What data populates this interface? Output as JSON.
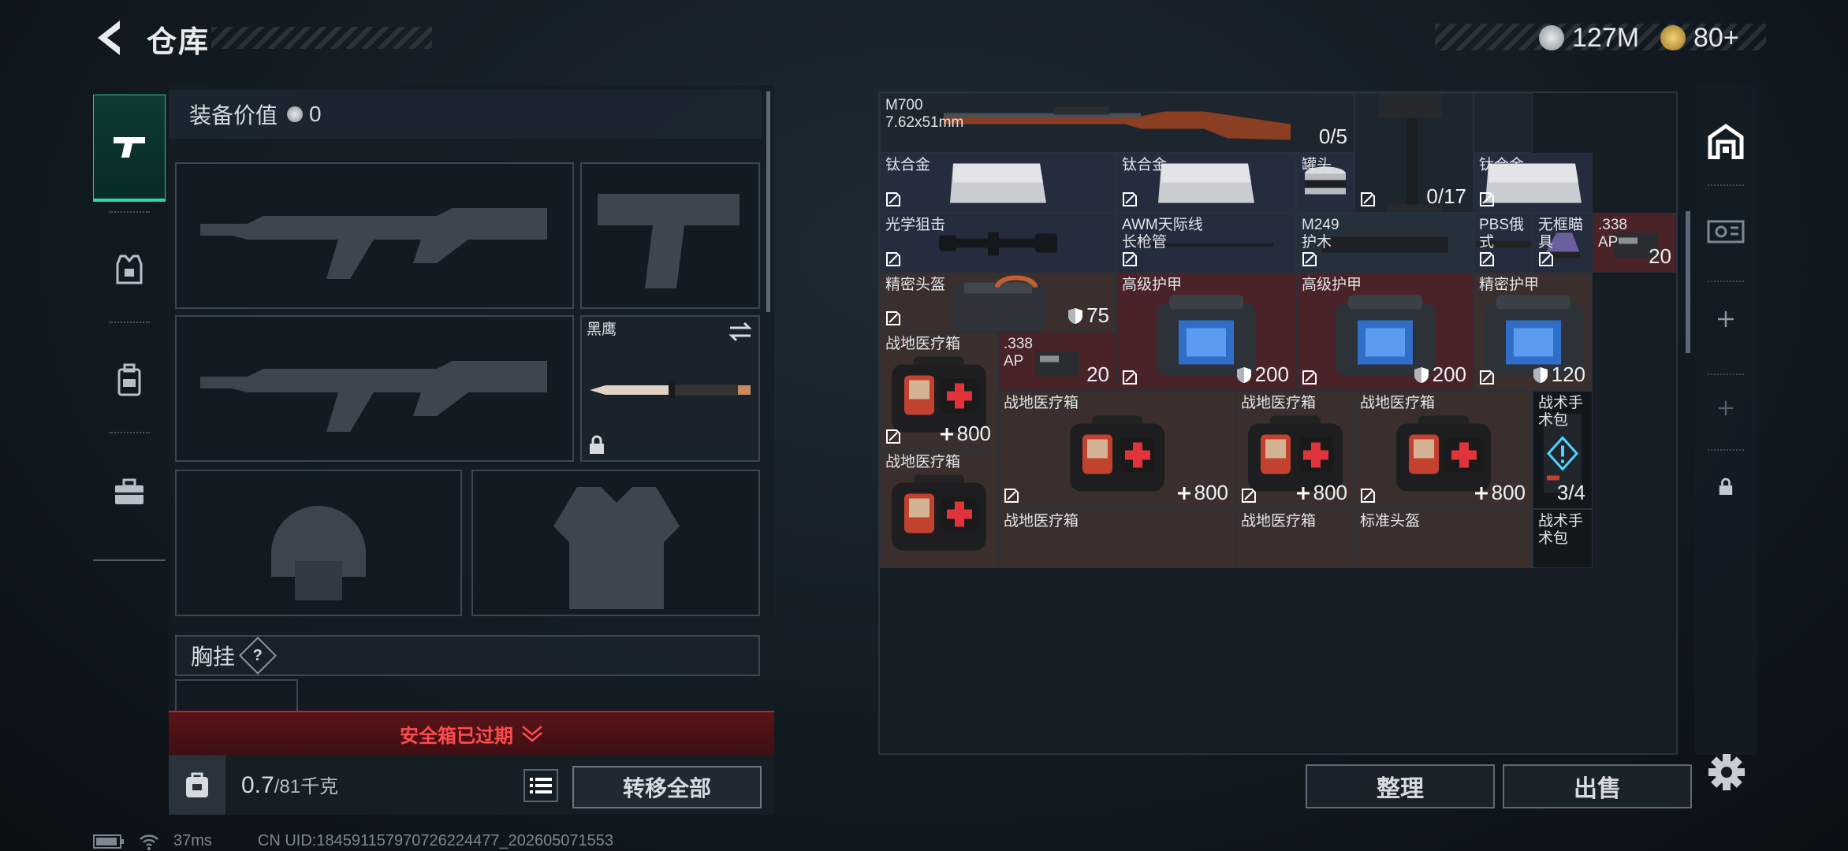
{
  "header": {
    "title": "仓库",
    "currency_silver": "127M",
    "currency_gold": "80+"
  },
  "left": {
    "equip_value_label": "装备价值",
    "equip_value": "0",
    "knife_name": "黑鹰",
    "chest_label": "胸挂",
    "chest_help": "?",
    "expired_text": "安全箱已过期",
    "weight_current": "0.7",
    "weight_max": "/81千克",
    "transfer_all": "转移全部"
  },
  "grid": {
    "m700_name": "M700\n7.62x51mm",
    "m700_count": "0/5",
    "c2_count": "0/17",
    "ti1": "钛合金",
    "ti2": "钛合金",
    "ti3": "钛合金",
    "can": "罐头",
    "optic": "光学狙击",
    "awm": "AWM天际线\n长枪管",
    "m249": "M249\n护木",
    "pbs": "PBS俄式",
    "reddot": "无框瞄具",
    "ammo1": ".338\nAP",
    "ammo1_count": "20",
    "helm1": "精密头盔",
    "helm1_val": "75",
    "armor1": "高级护甲",
    "armor1_val": "200",
    "armor2": "高级护甲",
    "armor2_val": "200",
    "armor3": "精密护甲",
    "armor3_val": "120",
    "med1": "战地医疗箱",
    "med1_val": "800",
    "ammo2": ".338\nAP",
    "ammo2_count": "20",
    "med2": "战地医疗箱",
    "med2_val": "800",
    "med3": "战地医疗箱",
    "med3_val": "800",
    "med4": "战地医疗箱",
    "med4_val": "800",
    "tac1": "战术手术包",
    "tac1_count": "3/4",
    "med5": "战地医疗箱",
    "med6": "战地医疗箱",
    "med7": "战地医疗箱",
    "helm2": "标准头盔",
    "tac2": "战术手术包"
  },
  "buttons": {
    "tidy": "整理",
    "sell": "出售"
  },
  "status": {
    "ping": "37ms",
    "uid": "CN UID:184591157970726224477_202605071553"
  },
  "colors": {
    "accent": "#2fd8a8",
    "expired": "#ff4a4f",
    "armor_cell": "#4a2329",
    "med_cell": "#3b2f2d"
  }
}
